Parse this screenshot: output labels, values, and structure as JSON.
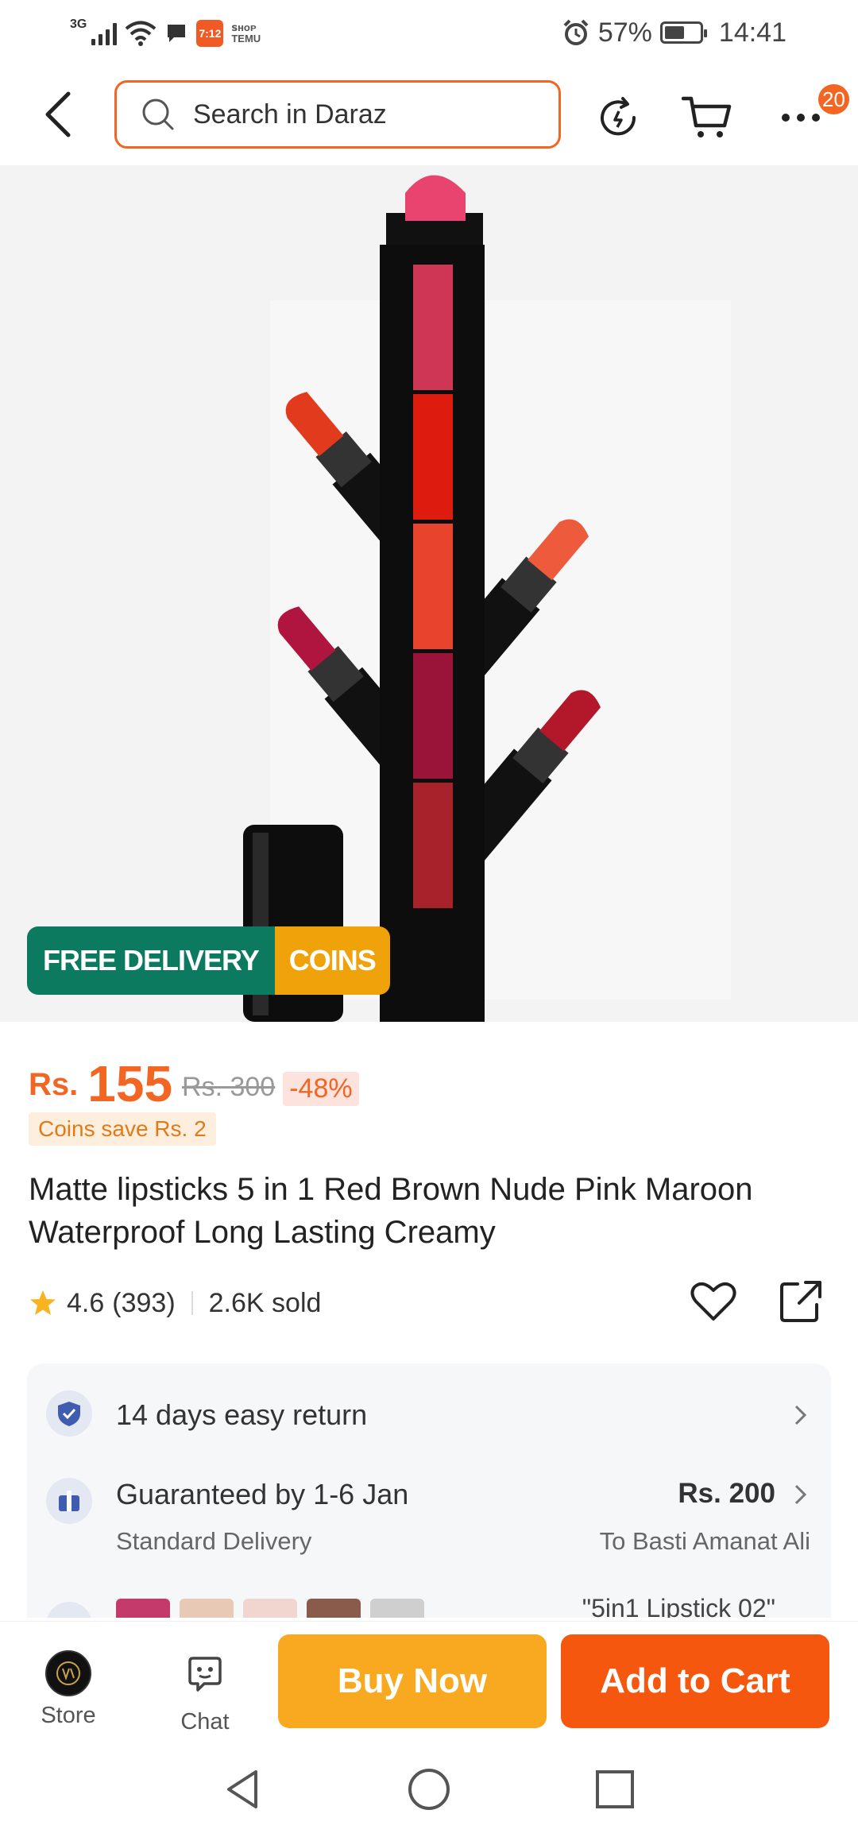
{
  "status_bar": {
    "network": "3G",
    "app_badge": "7:12",
    "temu_label_1": "ꜱʜᴏᴘ",
    "temu_label_2": "TEMU",
    "battery": "57%",
    "time": "14:41"
  },
  "header": {
    "search_placeholder": "Search in Daraz",
    "more_badge": "20"
  },
  "promo": {
    "free_delivery": "FREE DELIVERY",
    "coins": "COINS"
  },
  "price": {
    "currency": "Rs.",
    "current": "155",
    "original": "Rs. 300",
    "discount": "-48%",
    "coins_save": "Coins save Rs. 2"
  },
  "product": {
    "title": "Matte lipsticks 5 in 1 Red Brown Nude Pink Maroon Waterproof Long Lasting Creamy"
  },
  "rating": {
    "score": "4.6",
    "count": "(393)",
    "sold": "2.6K sold"
  },
  "services": {
    "return": "14 days easy return",
    "delivery_title": "Guaranteed by 1-6 Jan",
    "delivery_type": "Standard Delivery",
    "delivery_price": "Rs. 200",
    "delivery_to": "To Basti Amanat Ali",
    "variant_peek": "\"5in1 Lipstick 02\""
  },
  "bottom_bar": {
    "store": "Store",
    "chat": "Chat",
    "buy_now": "Buy Now",
    "add_to_cart": "Add to Cart"
  },
  "colors": {
    "accent": "#f26522",
    "buy_now": "#f8a91f",
    "add_to_cart": "#f5570f",
    "free_delivery": "#0b7a5e",
    "coins": "#f0a20b"
  }
}
